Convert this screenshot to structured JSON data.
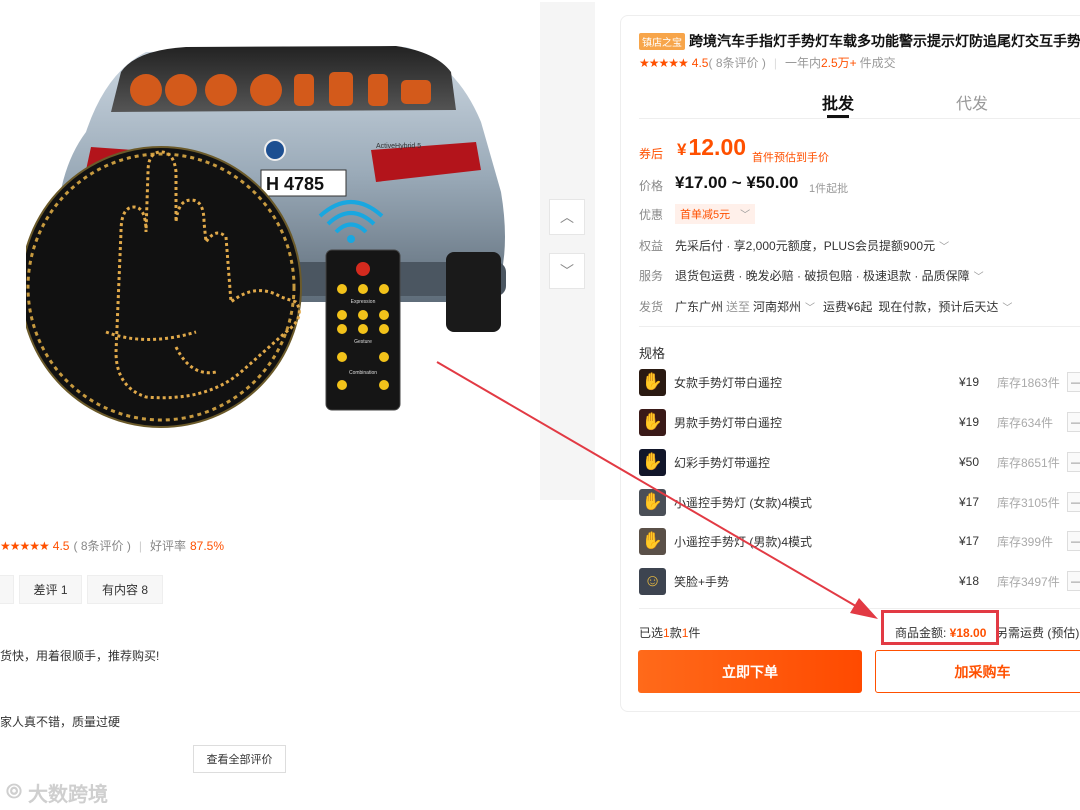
{
  "product": {
    "shop_badge": "镇店之宝",
    "title": "跨境汽车手指灯手势灯车载多功能警示提示灯防追尾灯交互手势",
    "rating_stars": "★★★★★",
    "rating_score": "4.5",
    "review_count": "( 8条评价 )",
    "sales_prefix": "一年内",
    "sales_count": "2.5万+",
    "sales_suffix": "件成交"
  },
  "image": {
    "plate_text": "H 4785",
    "car_badge": "ActiveHybrid 5",
    "remote_labels": [
      "Expression",
      "Gesture",
      "Combination"
    ]
  },
  "tabs": [
    "批发",
    "代发"
  ],
  "pricing": {
    "coupon_label": "券后",
    "coupon_price_yen": "¥",
    "coupon_price": "12.00",
    "coupon_note": "首件预估到手价",
    "price_label": "价格",
    "price_range": "¥17.00 ~ ¥50.00",
    "price_note": "1件起批",
    "promo_label": "优惠",
    "promo_badge": "首单减5元"
  },
  "info_rows": [
    {
      "label": "权益",
      "value": "先采后付 · 享2,000元额度，PLUS会员提额900元"
    },
    {
      "label": "服务",
      "value": "退货包运费 · 晚发必赔 · 破损包赔 · 极速退款 · 品质保障"
    },
    {
      "label": "发货",
      "from": "广东广州",
      "send_to": "送至",
      "to": "河南郑州",
      "fee": "运费¥6起",
      "eta": "现在付款，预计后天达"
    }
  ],
  "spec": {
    "title": "规格",
    "items": [
      {
        "name": "女款手势灯带白遥控",
        "price": "¥19",
        "stock": "库存1863件",
        "icon": "hand-orange"
      },
      {
        "name": "男款手势灯带白遥控",
        "price": "¥19",
        "stock": "库存634件",
        "icon": "hand-multi"
      },
      {
        "name": "幻彩手势灯带遥控",
        "price": "¥50",
        "stock": "库存8651件",
        "icon": "hand-blue"
      },
      {
        "name": "小遥控手势灯 (女款)4模式",
        "price": "¥17",
        "stock": "库存3105件",
        "icon": "hand-car"
      },
      {
        "name": "小遥控手势灯 (男款)4模式",
        "price": "¥17",
        "stock": "库存399件",
        "icon": "hand-car2"
      },
      {
        "name": "笑脸+手势",
        "price": "¥18",
        "stock": "库存3497件",
        "icon": "smile-car"
      }
    ],
    "minus": "—"
  },
  "summary": {
    "selected_pre": "已选",
    "selected_kinds": "1",
    "selected_mid": "款",
    "selected_count": "1",
    "selected_post": "件",
    "amount_label": "商品金额: ",
    "amount_value": "¥18.00",
    "shipping": "另需运费 (预估)"
  },
  "buttons": {
    "buy": "立即下单",
    "cart": "加采购车"
  },
  "reviews": {
    "stars": "★★★★★",
    "score": "4.5",
    "count": "( 8条评价 )",
    "sep": "|",
    "good_rate_label": "好评率",
    "good_rate": "87.5%",
    "tags": [
      "差评 1",
      "有内容 8"
    ],
    "texts": [
      "货快，用着很顺手，推荐购买!",
      "家人真不错，质量过硬"
    ],
    "view_all": "查看全部评价"
  },
  "watermark": "大数跨境",
  "colors": {
    "accent": "#ff5000",
    "annotation": "#e23a44"
  }
}
